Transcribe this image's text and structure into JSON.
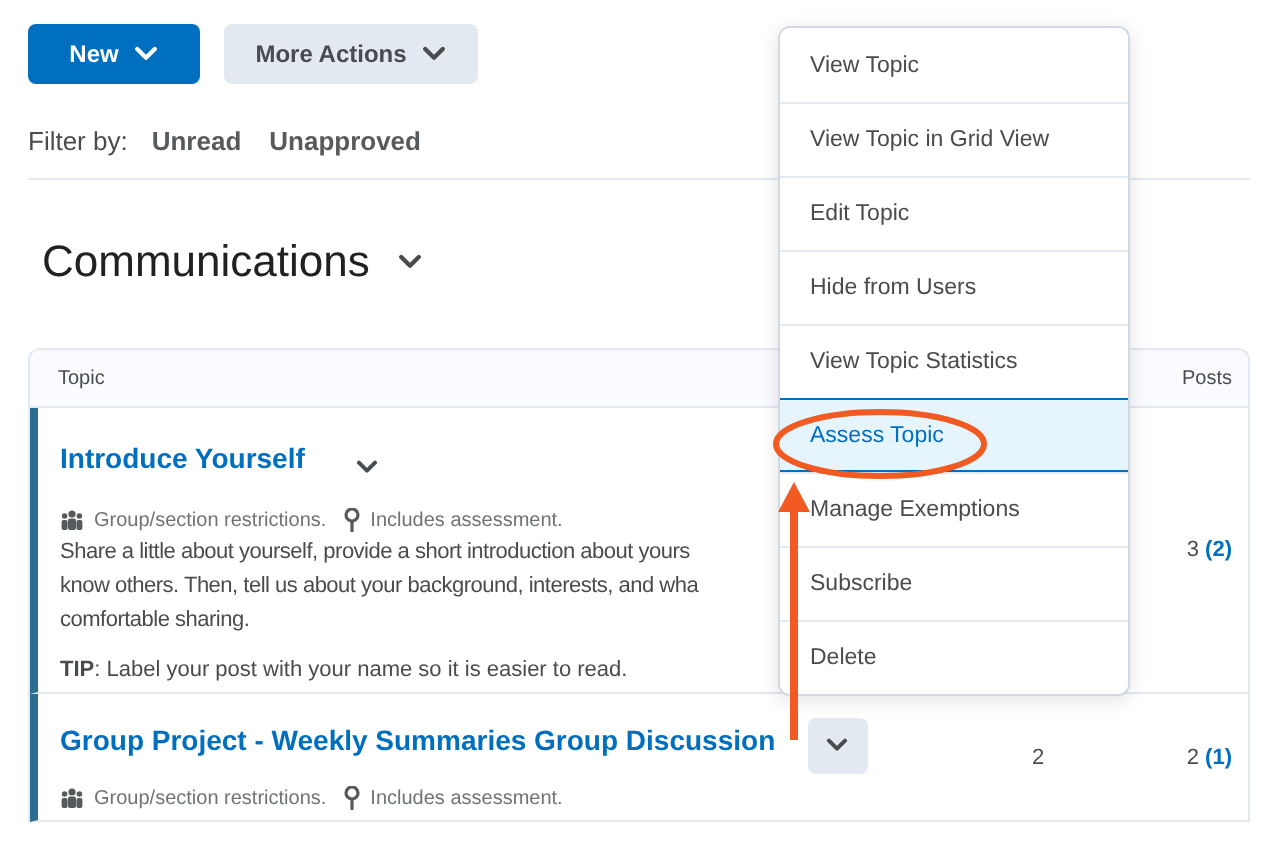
{
  "toolbar": {
    "buttons": [
      {
        "label": "New",
        "kind": "primary"
      },
      {
        "label": "More Actions",
        "kind": "secondary"
      }
    ]
  },
  "filter": {
    "label": "Filter by:",
    "options": [
      "Unread",
      "Unapproved"
    ]
  },
  "forum": {
    "title": "Communications"
  },
  "table": {
    "columns": [
      "Topic",
      "Posts"
    ],
    "rows": [
      {
        "title": "Introduce Yourself",
        "restriction": "Group/section restrictions.",
        "assessment": "Includes assessment.",
        "description": [
          "Share a little about yourself, provide a short introduction about yours",
          "know others. Then, tell us about your background, interests, and wha",
          "comfortable sharing."
        ],
        "tip": "**TIP**:  Label your post with your name so it is easier to read.",
        "menu_open": false,
        "column_2": "",
        "posts": "3",
        "unread": "(2)"
      },
      {
        "title": "Group Project - Weekly Summaries Group Discussion",
        "restriction": "Group/section restrictions.",
        "assessment": "Includes assessment.",
        "description": [],
        "tip": "",
        "menu_open": true,
        "column_2": "2",
        "posts": "2",
        "unread": "(1)"
      }
    ]
  },
  "context_menu": {
    "items": [
      {
        "label": "View Topic",
        "selected": false
      },
      {
        "label": "View Topic in Grid View",
        "selected": false
      },
      {
        "label": "Edit Topic",
        "selected": false
      },
      {
        "label": "Hide from Users",
        "selected": false
      },
      {
        "label": "View Topic Statistics",
        "selected": false
      },
      {
        "label": "Assess Topic",
        "selected": true
      },
      {
        "label": "Manage Exemptions",
        "selected": false
      },
      {
        "label": "Subscribe",
        "selected": false
      },
      {
        "label": "Delete",
        "selected": false
      }
    ]
  }
}
